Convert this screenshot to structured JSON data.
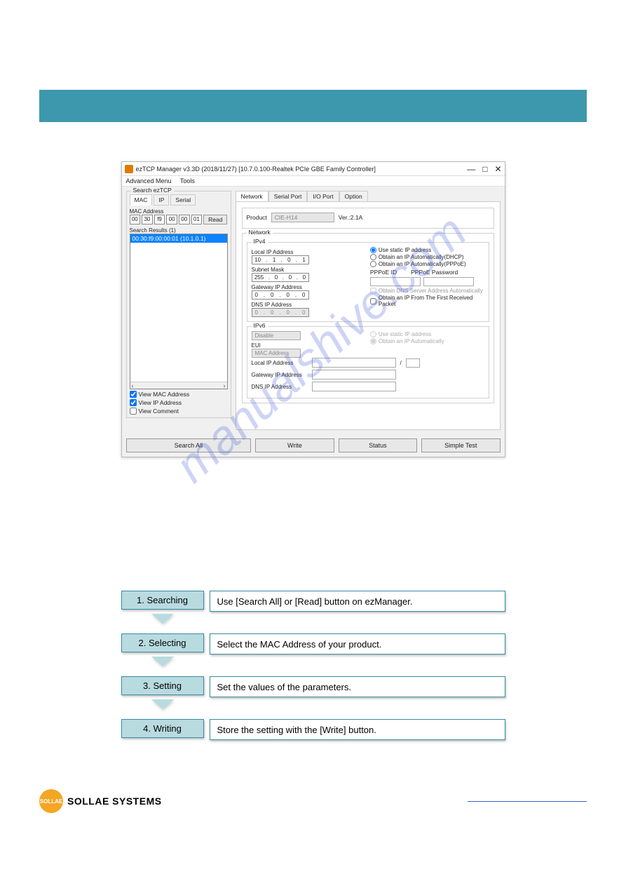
{
  "window": {
    "title": "ezTCP Manager v3.3D (2018/11/27) [10.7.0.100-Realtek PCIe GBE Family Controller]",
    "menu": {
      "adv": "Advanced Menu",
      "tools": "Tools"
    },
    "win_min": "—",
    "win_max": "□",
    "win_close": "✕"
  },
  "left": {
    "group": "Search ezTCP",
    "tabs": {
      "mac": "MAC",
      "ip": "IP",
      "serial": "Serial"
    },
    "macLabel": "MAC Address",
    "mac": [
      "00",
      "30",
      "f9",
      "00",
      "00",
      "01"
    ],
    "readBtn": "Read",
    "resultsLabel": "Search Results (1)",
    "resultRow": "00:30:f9:00:00:01 (10.1.0.1)",
    "chkMac": "View MAC Address",
    "chkIp": "View IP Address",
    "chkComment": "View Comment"
  },
  "right": {
    "tabs": {
      "network": "Network",
      "serial": "Serial Port",
      "io": "I/O Port",
      "option": "Option"
    },
    "productLabel": "Product",
    "productValue": "CIE-H14",
    "verLabel": "Ver.:2.1A",
    "networkLabel": "Network",
    "ipv4": {
      "title": "IPv4",
      "localLabel": "Local IP Address",
      "local": [
        "10",
        "1",
        "0",
        "1"
      ],
      "subnetLabel": "Subnet Mask",
      "subnet": [
        "255",
        "0",
        "0",
        "0"
      ],
      "gatewayLabel": "Gateway IP Address",
      "gateway": [
        "0",
        "0",
        "0",
        "0"
      ],
      "dnsLabel": "DNS IP Address",
      "dns": [
        "0",
        "0",
        "0",
        "0"
      ],
      "rStatic": "Use static IP address",
      "rDhcp": "Obtain an IP Automatically(DHCP)",
      "rPppoe": "Obtain an IP Automatically(PPPoE)",
      "pppoeId": "PPPoE ID",
      "pppoePw": "PPPoE Password",
      "cbDns": "Obtain DNS Server Address Automatically",
      "cbFirst": "Obtain an IP From The First Received Packet"
    },
    "ipv6": {
      "title": "IPv6",
      "disable": "Disable",
      "euiLabel": "EUI",
      "eui": "MAC Address",
      "rStatic": "Use static IP address",
      "rAuto": "Obtain an IP Automatically",
      "localLabel": "Local IP Address",
      "gwLabel": "Gateway IP Address",
      "dnsLabel": "DNS IP Address",
      "slash": "/"
    }
  },
  "buttons": {
    "searchAll": "Search All",
    "write": "Write",
    "status": "Status",
    "simple": "Simple Test"
  },
  "watermark": "manualshive.com",
  "steps": [
    {
      "title": "1. Searching",
      "desc": "Use [Search All] or [Read] button on ezManager."
    },
    {
      "title": "2. Selecting",
      "desc": "Select the MAC Address of your product."
    },
    {
      "title": "3. Setting",
      "desc": "Set the values of the parameters."
    },
    {
      "title": "4. Writing",
      "desc": "Store the setting with the [Write] button."
    }
  ],
  "footer": {
    "logo": "SOLLAE",
    "text": "SOLLAE SYSTEMS"
  }
}
